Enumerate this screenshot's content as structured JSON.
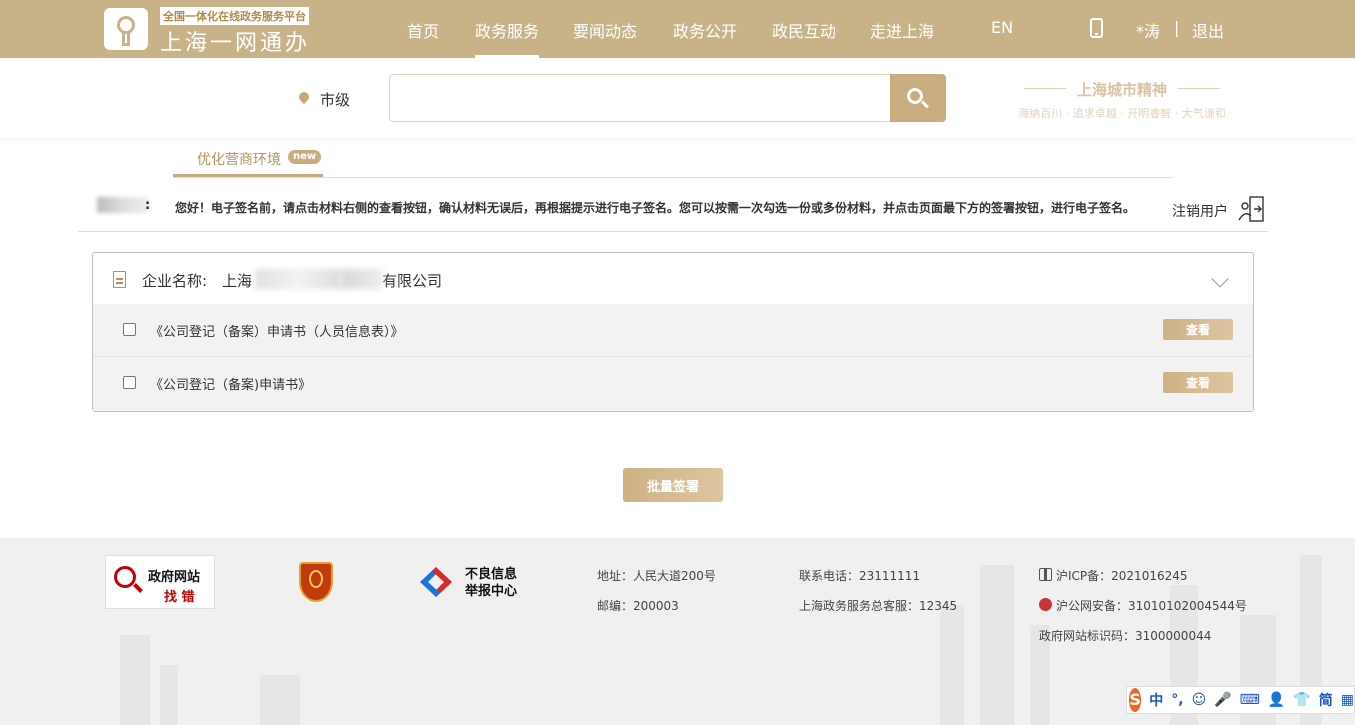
{
  "header": {
    "logo_subtitle": "全国一体化在线政务服务平台",
    "logo_title": "上海一网通办",
    "nav": [
      "首页",
      "政务服务",
      "要闻动态",
      "政务公开",
      "政民互动",
      "走进上海",
      "EN"
    ],
    "active_nav_index": 1,
    "user_name": "*涛",
    "separator": "|",
    "logout": "退出"
  },
  "search": {
    "location": "市级",
    "placeholder": ""
  },
  "spirit": {
    "title": "上海城市精神",
    "subtitle": "海纳百川 · 追求卓越 · 开明睿智 · 大气谦和"
  },
  "tab": {
    "label": "优化营商环境",
    "badge": "new"
  },
  "notice": {
    "colon": ":",
    "text": "您好！电子签名前，请点击材料右侧的查看按钮，确认材料无误后，再根据提示进行电子签名。您可以按需一次勾选一份或多份材料，并点击页面最下方的签署按钮，进行电子签名。",
    "cancel_user": "注销用户"
  },
  "company": {
    "label": "企业名称:",
    "name_prefix": "上海",
    "name_suffix": "有限公司"
  },
  "documents": [
    {
      "label": "《公司登记（备案）申请书（人员信息表）》",
      "action": "查看",
      "checked": false
    },
    {
      "label": "《公司登记（备案)申请书》",
      "action": "查看",
      "checked": false
    }
  ],
  "batch_sign": "批量签署",
  "footer": {
    "gov_site_line1": "政府网站",
    "gov_site_line2": "找 错",
    "report_line1": "不良信息",
    "report_line2": "举报中心",
    "address": "地址：人民大道200号",
    "postcode": "邮编：200003",
    "phone": "联系电话：23111111",
    "hotline": "上海政务服务总客服：12345",
    "icp": "沪ICP备：2021016245",
    "police": "沪公网安备：31010102004544号",
    "site_code": "政府网站标识码：3100000044"
  },
  "ime": {
    "logo": "S",
    "items": [
      "中",
      "°,",
      "☺",
      "🎤",
      "⌨",
      "👤",
      "👕",
      "简",
      "▦"
    ]
  },
  "colors": {
    "header_bg": "#c8b389",
    "accent": "#c8ad80",
    "tab_text": "#b39260"
  }
}
